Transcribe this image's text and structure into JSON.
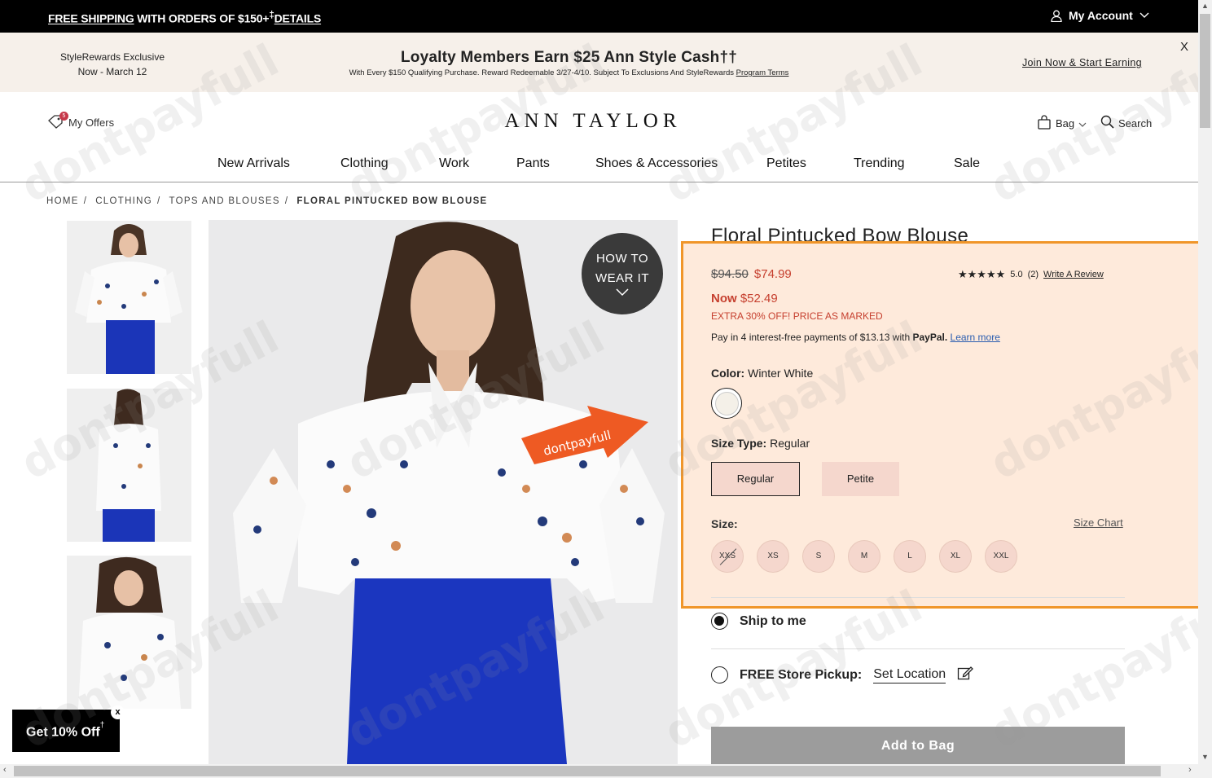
{
  "topbar": {
    "free_shipping": "FREE SHIPPING",
    "promo_text": " WITH ORDERS OF $150+",
    "promo_sup": "‡",
    "details_link": "DETAILS",
    "my_account": "My Account"
  },
  "loyalty": {
    "left_line1": "StyleRewards Exclusive",
    "left_line2": "Now - March 12",
    "headline": "Loyalty Members Earn $25 Ann Style Cash††",
    "subline": "With Every $150 Qualifying Purchase. Reward Redeemable 3/27-4/10. Subject To Exclusions And StyleRewards ",
    "program_terms": "Program Terms",
    "join_link": "Join Now & Start Earning",
    "close": "X"
  },
  "header": {
    "my_offers": "My Offers",
    "offers_count": "5",
    "logo": "ANN TAYLOR",
    "bag": "Bag",
    "search": "Search"
  },
  "nav": [
    "New Arrivals",
    "Clothing",
    "Work",
    "Pants",
    "Shoes & Accessories",
    "Petites",
    "Trending",
    "Sale"
  ],
  "breadcrumbs": [
    "HOME",
    "CLOTHING",
    "TOPS AND BLOUSES",
    "FLORAL PINTUCKED BOW BLOUSE"
  ],
  "how_to": {
    "line1": "HOW TO",
    "line2": "WEAR IT"
  },
  "watermark": "dontpayfull",
  "product": {
    "title": "Floral Pintucked Bow Blouse",
    "original_price": "$94.50",
    "sale_price": "$74.99",
    "rating_value": "5.0",
    "rating_count": "(2)",
    "stars": "★★★★★",
    "write_review": "Write A Review",
    "now_label": "Now",
    "now_price": "$52.49",
    "extra_offer": "EXTRA 30% OFF! PRICE AS MARKED",
    "paypal_text": "Pay in 4 interest-free payments of $13.13 with ",
    "paypal_brand": "PayPal.",
    "learn_more": "Learn more",
    "color_label": "Color:",
    "color_value": "Winter White",
    "size_type_label": "Size Type:",
    "size_type_value": "Regular",
    "size_type_options": [
      "Regular",
      "Petite"
    ],
    "size_label": "Size:",
    "size_chart": "Size Chart",
    "sizes": [
      "XXS",
      "XS",
      "S",
      "M",
      "L",
      "XL",
      "XXL"
    ],
    "ship_to_me": "Ship to me",
    "free_pickup": "FREE Store Pickup:",
    "set_location": "Set Location",
    "add_to_bag": "Add to Bag"
  },
  "popup": {
    "label": "Get 10% Off",
    "sup": "†",
    "close": "x"
  },
  "colors": {
    "accent_orange": "#f0962a",
    "sale_red": "#c6402f",
    "panel_bg": "#feeadb"
  }
}
